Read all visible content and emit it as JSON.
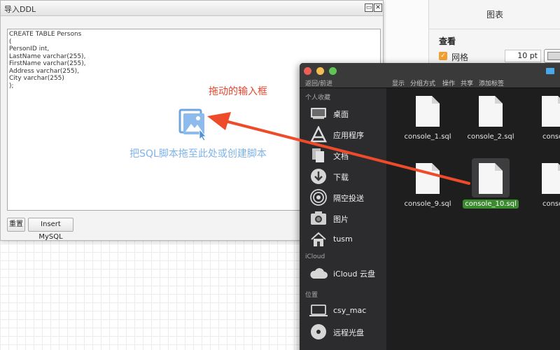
{
  "format_panel": {
    "title": "图表",
    "section_title": "查看",
    "grid_label": "网格",
    "grid_size": "10 pt",
    "grid_checked": true
  },
  "dialog": {
    "title": "导入DDL",
    "minimize": "▭",
    "close": "✕",
    "ddl_text": "CREATE TABLE Persons\n(\nPersonID int,\nLastName varchar(255),\nFirstName varchar(255),\nAddress varchar(255),\nCity varchar(255)\n);",
    "drop_hint": "把SQL脚本拖至此处或创建脚本",
    "reset_button": "重置",
    "insert_button": "Insert MySQL"
  },
  "annotation": {
    "text": "拖动的输入框",
    "color": "#e8452c"
  },
  "finder": {
    "nav_label": "返回/前进",
    "toolbar": [
      "显示",
      "分组方式",
      "操作",
      "共享",
      "添加标签"
    ],
    "sidebar": {
      "favorites_header": "个人收藏",
      "favorites": [
        {
          "label": "桌面",
          "icon": "desktop-icon"
        },
        {
          "label": "应用程序",
          "icon": "applications-icon"
        },
        {
          "label": "文档",
          "icon": "documents-icon"
        },
        {
          "label": "下载",
          "icon": "downloads-icon"
        },
        {
          "label": "隔空投送",
          "icon": "airdrop-icon"
        },
        {
          "label": "图片",
          "icon": "pictures-icon"
        },
        {
          "label": "tusm",
          "icon": "home-icon"
        }
      ],
      "icloud_header": "iCloud",
      "icloud": [
        {
          "label": "iCloud 云盘",
          "icon": "cloud-icon"
        }
      ],
      "locations_header": "位置",
      "locations": [
        {
          "label": "csy_mac",
          "icon": "laptop-icon"
        },
        {
          "label": "远程光盘",
          "icon": "disc-icon"
        }
      ]
    },
    "files": [
      {
        "name": "console_1.sql",
        "selected": false
      },
      {
        "name": "console_2.sql",
        "selected": false
      },
      {
        "name": "consol",
        "selected": false
      },
      {
        "name": "console_9.sql",
        "selected": false
      },
      {
        "name": "console_10.sql",
        "selected": true
      },
      {
        "name": "consol",
        "selected": false
      }
    ]
  }
}
